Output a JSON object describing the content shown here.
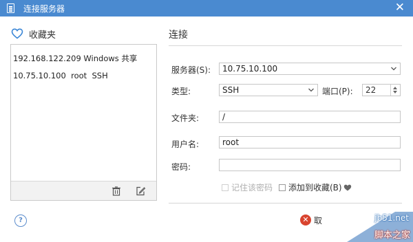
{
  "window": {
    "title": "连接服务器",
    "close_glyph": "✕",
    "icon": "document-icon",
    "titlebar_color": "#4a8ad0"
  },
  "favorites": {
    "header": "收藏夹",
    "items": [
      "192.168.122.209 Windows 共享",
      "10.75.10.100  root  SSH"
    ],
    "toolbar": {
      "delete_icon": "trash-icon",
      "edit_icon": "edit-icon"
    }
  },
  "help": {
    "label": "?"
  },
  "connection": {
    "title": "连接",
    "server_label": "服务器(S):",
    "server_value": "10.75.10.100",
    "type_label": "类型:",
    "type_value": "SSH",
    "port_label": "端口(P):",
    "port_value": "22",
    "folder_label": "文件夹:",
    "folder_value": "/",
    "username_label": "用户名:",
    "username_value": "root",
    "password_label": "密码:",
    "password_value": "",
    "remember_password_label": "记住该密码",
    "add_to_favorites_label": "添加到收藏(B)"
  },
  "buttons": {
    "cancel_label": "取",
    "cancel_icon": "x-circle-icon",
    "cancel_color": "#d9442f"
  },
  "watermark": {
    "site": "jb51.net",
    "name": "脚本之家"
  }
}
